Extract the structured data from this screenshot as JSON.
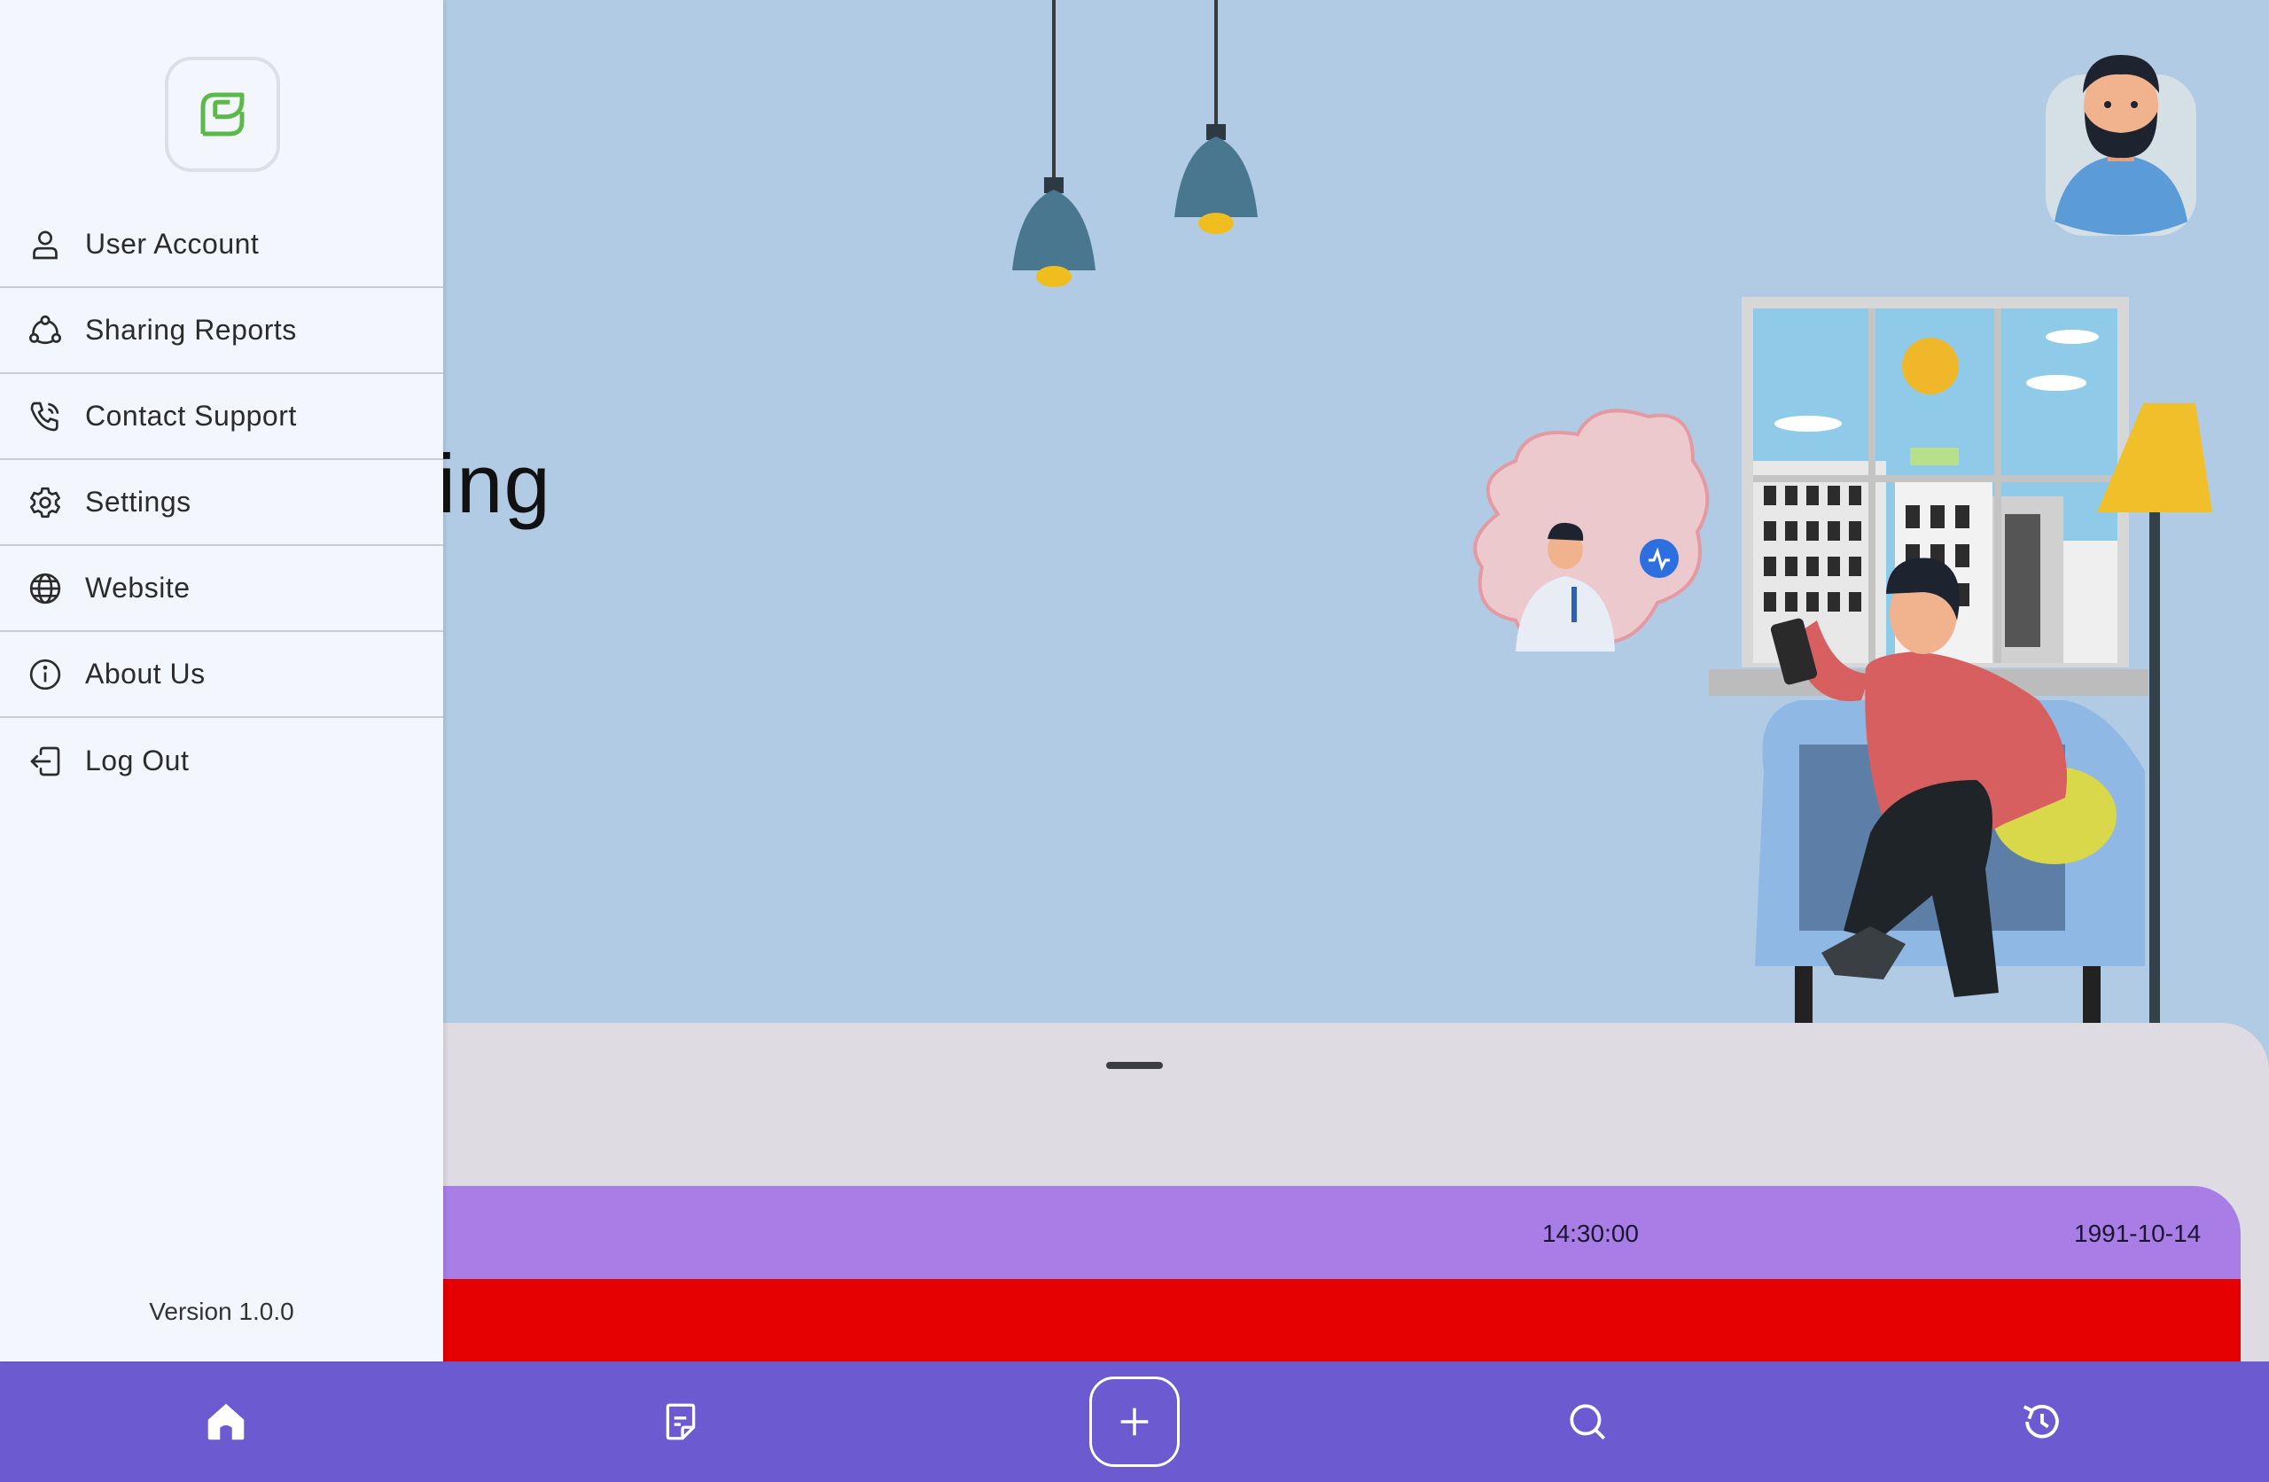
{
  "screen": {
    "partial_heading": "ning",
    "colors": {
      "scene_background": "#b2cbe4",
      "drawer_background": "#f3f7fd",
      "nav_background": "#6b5ad0",
      "record_header": "#a87ee6",
      "record_bar": "#e50102",
      "sheet_background": "#dedbe2",
      "logo_green": "#5bb84a"
    }
  },
  "drawer": {
    "logo_icon": "leaf-logo-icon",
    "items": [
      {
        "label": "User Account",
        "icon": "user-icon"
      },
      {
        "label": "Sharing Reports",
        "icon": "share-icon"
      },
      {
        "label": "Contact Support",
        "icon": "phone-icon"
      },
      {
        "label": "Settings",
        "icon": "gear-icon"
      },
      {
        "label": "Website",
        "icon": "globe-icon"
      },
      {
        "label": "About Us",
        "icon": "info-icon"
      },
      {
        "label": "Log Out",
        "icon": "logout-icon"
      }
    ],
    "version": "Version 1.0.0"
  },
  "record": {
    "time": "14:30:00",
    "date": "1991-10-14"
  },
  "bottom_nav": {
    "items": [
      {
        "icon": "home-icon",
        "active": true
      },
      {
        "icon": "document-icon"
      },
      {
        "icon": "add-icon"
      },
      {
        "icon": "search-icon"
      },
      {
        "icon": "history-icon"
      }
    ]
  }
}
